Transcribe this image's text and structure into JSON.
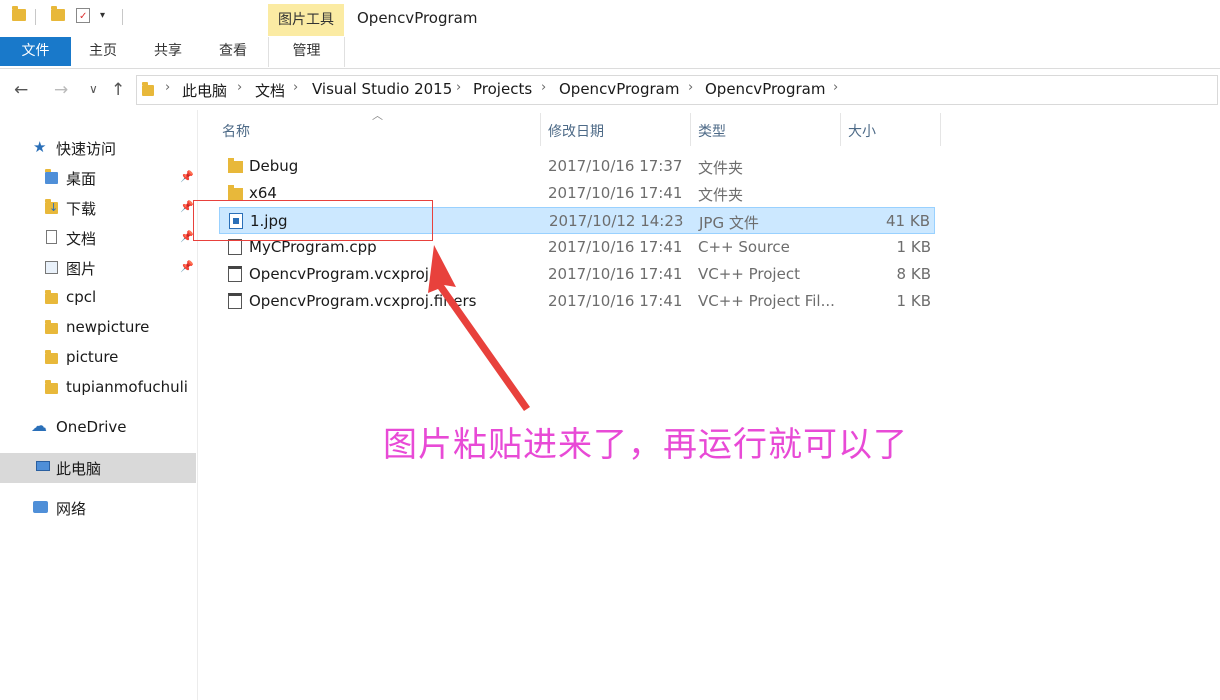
{
  "window": {
    "title": "OpencvProgram",
    "context_tab": "图片工具"
  },
  "ribbon": {
    "file_tab": "文件",
    "tabs": [
      "主页",
      "共享",
      "查看"
    ],
    "manage_tab": "管理"
  },
  "breadcrumb": [
    "此电脑",
    "文档",
    "Visual Studio 2015",
    "Projects",
    "OpencvProgram",
    "OpencvProgram"
  ],
  "sidebar": {
    "quick_access": "快速访问",
    "pinned": [
      {
        "label": "桌面",
        "icon": "desktop-folder-icon"
      },
      {
        "label": "下载",
        "icon": "download-folder-icon"
      },
      {
        "label": "文档",
        "icon": "documents-folder-icon"
      },
      {
        "label": "图片",
        "icon": "pictures-folder-icon"
      }
    ],
    "folders": [
      "cpcl",
      "newpicture",
      "picture",
      "tupianmofuchuli"
    ],
    "onedrive": "OneDrive",
    "this_pc": "此电脑",
    "network": "网络"
  },
  "columns": {
    "name": "名称",
    "date": "修改日期",
    "type": "类型",
    "size": "大小"
  },
  "files": [
    {
      "name": "Debug",
      "date": "2017/10/16 17:37",
      "type": "文件夹",
      "size": "",
      "icon": "folder-icon"
    },
    {
      "name": "x64",
      "date": "2017/10/16 17:41",
      "type": "文件夹",
      "size": "",
      "icon": "folder-icon"
    },
    {
      "name": "1.jpg",
      "date": "2017/10/12 14:23",
      "type": "JPG 文件",
      "size": "41 KB",
      "icon": "image-file-icon",
      "selected": true
    },
    {
      "name": "MyCProgram.cpp",
      "date": "2017/10/16 17:41",
      "type": "C++ Source",
      "size": "1 KB",
      "icon": "cpp-file-icon"
    },
    {
      "name": "OpencvProgram.vcxproj",
      "date": "2017/10/16 17:41",
      "type": "VC++ Project",
      "size": "8 KB",
      "icon": "vcxproj-file-icon"
    },
    {
      "name": "OpencvProgram.vcxproj.filters",
      "date": "2017/10/16 17:41",
      "type": "VC++ Project Fil...",
      "size": "1 KB",
      "icon": "filters-file-icon"
    }
  ],
  "annotation": {
    "text": "图片粘贴进来了，再运行就可以了",
    "box_color": "#e8413c",
    "arrow_color": "#e8413c",
    "text_color": "#e84ad6"
  },
  "colors": {
    "accent": "#1979ca",
    "selection": "#cce8ff",
    "context_tab": "#fbeba3"
  }
}
